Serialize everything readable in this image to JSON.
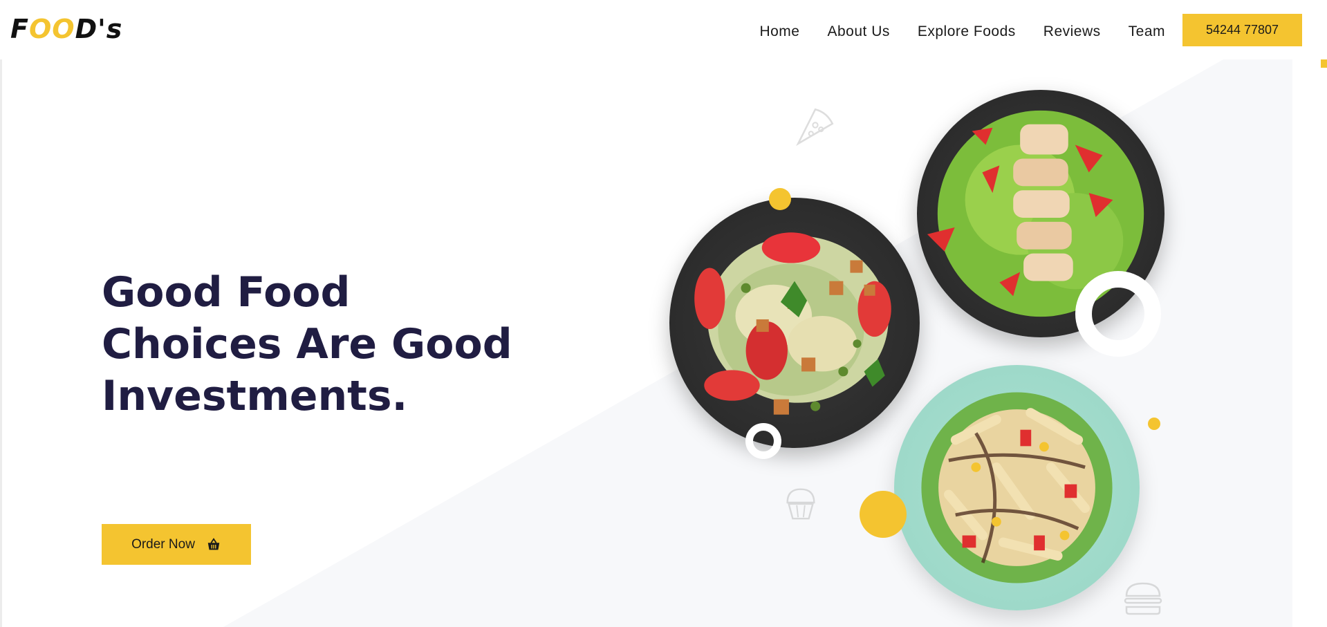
{
  "brand": {
    "logo_f": "F",
    "logo_oo": "OO",
    "logo_rest": "D's"
  },
  "nav": {
    "items": [
      "Home",
      "About Us",
      "Explore Foods",
      "Reviews",
      "Team"
    ],
    "phone": "54244 77807"
  },
  "hero": {
    "headline": "Good Food Choices Are Good Investments.",
    "cta": "Order Now",
    "cta_icon": "basket-icon",
    "plates": [
      "salad-plate",
      "chicken-salad-plate",
      "pasta-salad-plate"
    ],
    "decor_icons": [
      "pizza-slice-icon",
      "cupcake-icon",
      "burger-icon"
    ]
  },
  "colors": {
    "accent": "#f4c430",
    "headline": "#201d42",
    "text": "#1a1a1a",
    "diagonal_bg": "#f7f8fa"
  }
}
